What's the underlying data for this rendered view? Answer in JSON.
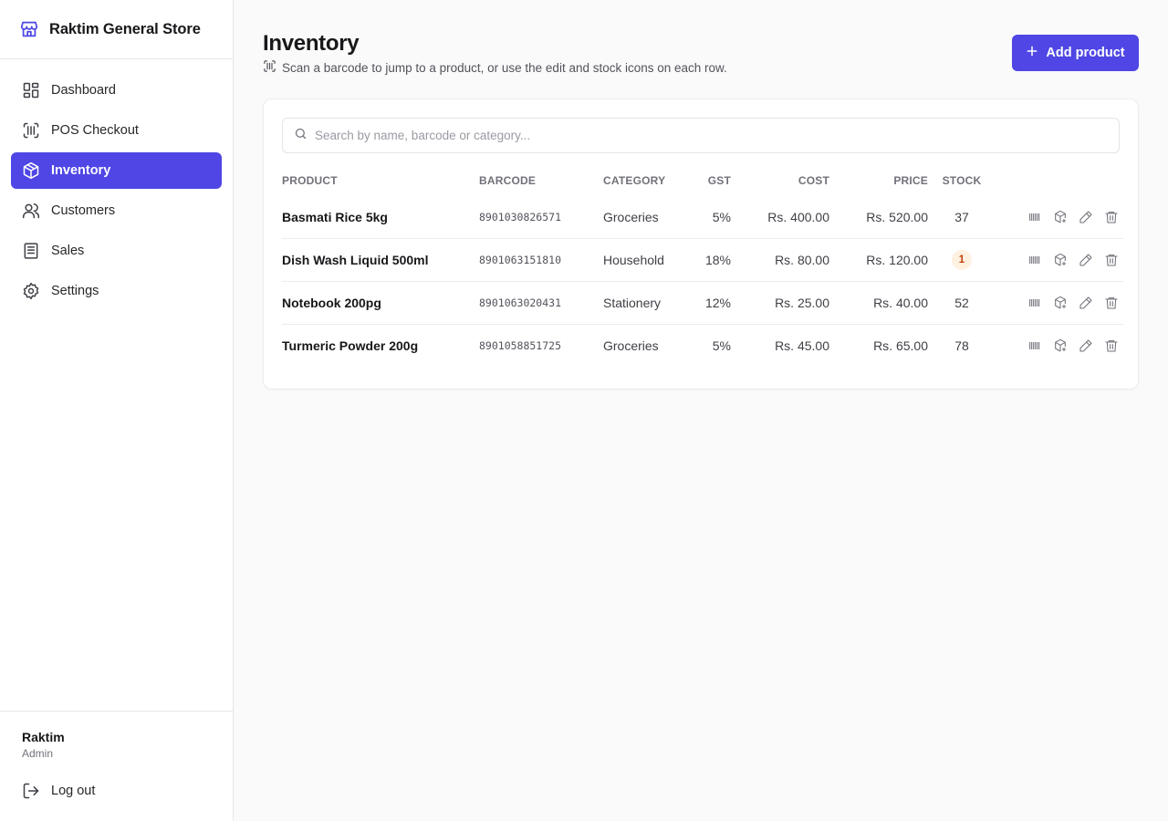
{
  "brand": {
    "name": "Raktim General Store",
    "icon": "store-icon"
  },
  "sidebar": {
    "items": [
      {
        "label": "Dashboard",
        "icon": "dashboard-icon"
      },
      {
        "label": "POS Checkout",
        "icon": "scan-icon"
      },
      {
        "label": "Inventory",
        "icon": "package-icon",
        "active": true
      },
      {
        "label": "Customers",
        "icon": "users-icon"
      },
      {
        "label": "Sales",
        "icon": "receipt-icon"
      },
      {
        "label": "Settings",
        "icon": "gear-icon"
      }
    ],
    "user": {
      "name": "Raktim",
      "role": "Admin"
    },
    "logout_label": "Log out"
  },
  "page": {
    "title": "Inventory",
    "subtitle": "Scan a barcode to jump to a product, or use the edit and stock icons on each row.",
    "add_button": "Add product"
  },
  "search": {
    "placeholder": "Search by name, barcode or category...",
    "value": ""
  },
  "table": {
    "columns": [
      "PRODUCT",
      "BARCODE",
      "CATEGORY",
      "GST",
      "COST",
      "PRICE",
      "STOCK"
    ],
    "rows": [
      {
        "product": "Basmati Rice 5kg",
        "barcode": "8901030826571",
        "category": "Groceries",
        "gst": "5%",
        "cost": "Rs. 400.00",
        "price": "Rs. 520.00",
        "stock": "37",
        "low": false
      },
      {
        "product": "Dish Wash Liquid 500ml",
        "barcode": "8901063151810",
        "category": "Household",
        "gst": "18%",
        "cost": "Rs. 80.00",
        "price": "Rs. 120.00",
        "stock": "1",
        "low": true
      },
      {
        "product": "Notebook 200pg",
        "barcode": "8901063020431",
        "category": "Stationery",
        "gst": "12%",
        "cost": "Rs. 25.00",
        "price": "Rs. 40.00",
        "stock": "52",
        "low": false
      },
      {
        "product": "Turmeric Powder 200g",
        "barcode": "8901058851725",
        "category": "Groceries",
        "gst": "5%",
        "cost": "Rs. 45.00",
        "price": "Rs. 65.00",
        "stock": "78",
        "low": false
      }
    ],
    "row_actions": [
      "barcode-icon",
      "stock-adjust-icon",
      "edit-icon",
      "delete-icon"
    ]
  },
  "colors": {
    "accent": "#4f46e5",
    "low_stock_bg": "#fff1e0",
    "low_stock_text": "#c2410c"
  }
}
